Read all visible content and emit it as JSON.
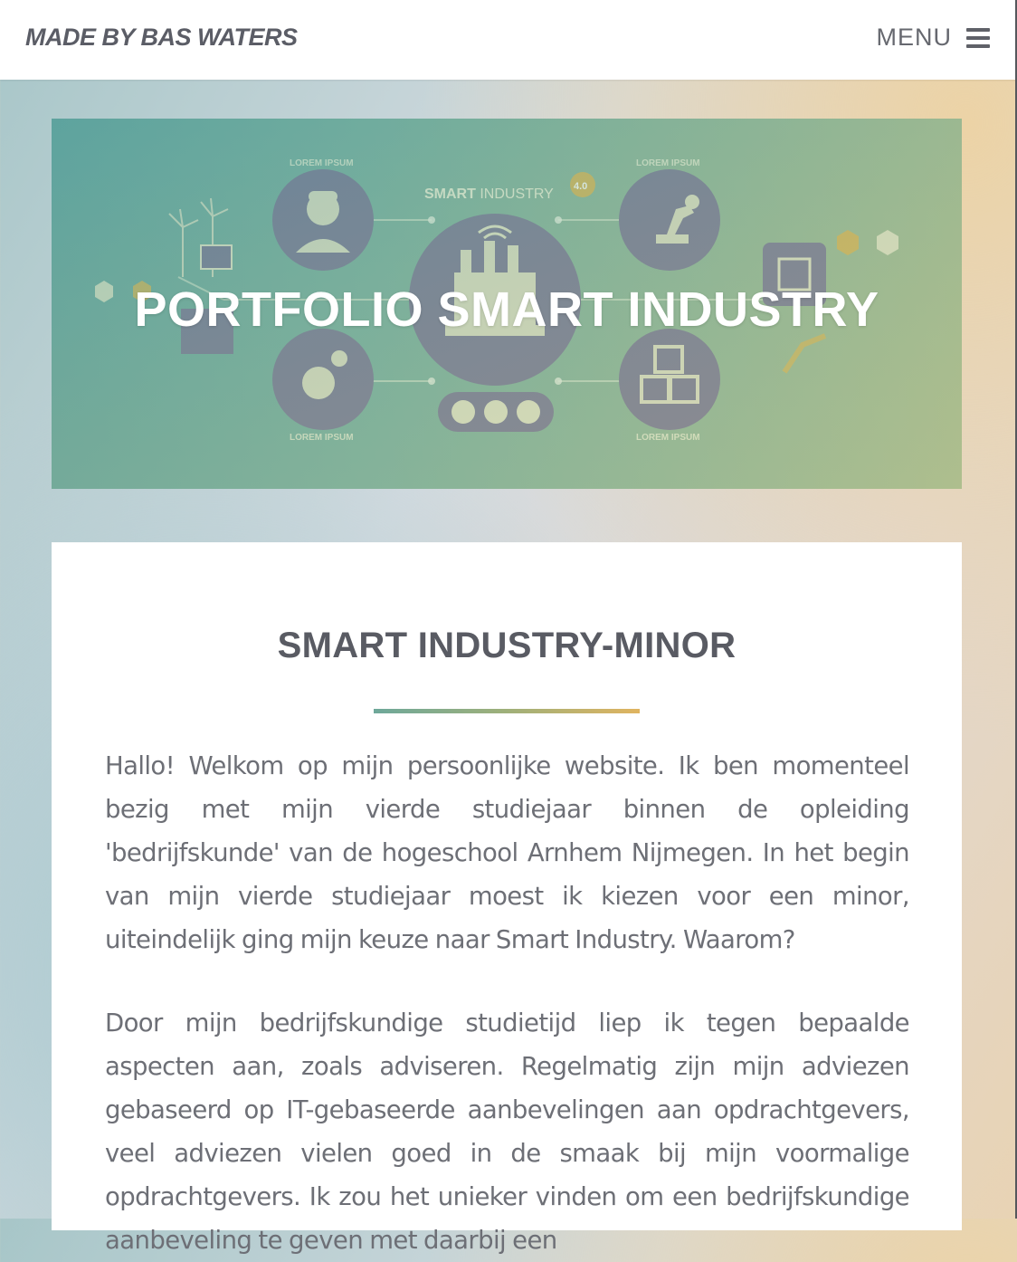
{
  "header": {
    "brand": "MADE BY BAS WATERS",
    "menu_label": "MENU"
  },
  "hero": {
    "title": "PORTFOLIO SMART INDUSTRY",
    "image_labels": {
      "lorem": "LOREM IPSUM",
      "smart": "SMART",
      "industry": "INDUSTRY",
      "version": "4.0"
    }
  },
  "content": {
    "heading": "SMART INDUSTRY-MINOR",
    "paragraphs": [
      "Hallo! Welkom op mijn persoonlijke website. Ik ben momenteel bezig met mijn vierde studiejaar binnen de opleiding 'bedrijfskunde' van de hogeschool Arnhem Nijmegen. In het begin van mijn vierde studiejaar moest ik kiezen voor een minor, uiteindelijk ging mijn keuze naar Smart Industry. Waarom?",
      "Door mijn bedrijfskundige studietijd liep ik tegen bepaalde aspecten aan, zoals adviseren. Regelmatig zijn mijn adviezen gebaseerd op IT-gebaseerde aanbevelingen aan opdrachtgevers, veel adviezen vielen goed in de smaak bij mijn voormalige opdrachtgevers. Ik zou het unieker vinden om een bedrijfskundige aanbeveling te geven met daarbij een"
    ]
  },
  "colors": {
    "accent_teal": "#6ea89a",
    "accent_gold": "#e0b460",
    "text_gray": "#6d6f76",
    "heading_gray": "#595b63"
  }
}
